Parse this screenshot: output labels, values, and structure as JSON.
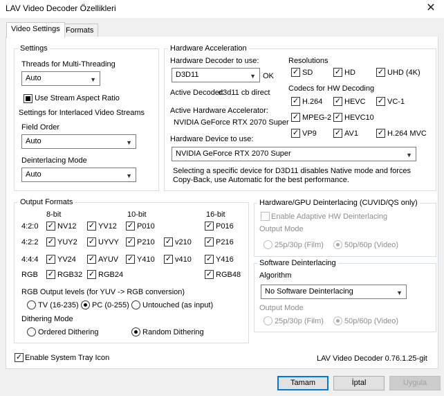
{
  "window": {
    "title": "LAV Video Decoder Özellikleri",
    "close_glyph": "✕"
  },
  "tabs": [
    {
      "label": "Video Settings"
    },
    {
      "label": "Formats"
    }
  ],
  "settings": {
    "group_label": "Settings",
    "threads_label": "Threads for Multi-Threading",
    "threads_value": "Auto",
    "stream_aspect_label": "Use Stream Aspect Ratio",
    "interlaced_label": "Settings for Interlaced Video Streams",
    "field_order_label": "Field Order",
    "field_order_value": "Auto",
    "deint_mode_label": "Deinterlacing Mode",
    "deint_mode_value": "Auto"
  },
  "hwaccel": {
    "group_label": "Hardware Acceleration",
    "decoder_label": "Hardware Decoder to use:",
    "decoder_value": "D3D11",
    "decoder_status": "OK",
    "active_decoder_label": "Active Decoder:",
    "active_decoder_value": "d3d11 cb direct",
    "active_accel_label": "Active Hardware Accelerator:",
    "active_accel_value": "NVIDIA GeForce RTX 2070 Super",
    "device_label": "Hardware Device to use:",
    "device_value": "NVIDIA GeForce RTX 2070 Super",
    "note_line1": "Selecting a specific device for D3D11 disables Native mode and forces",
    "note_line2": "Copy-Back, use Automatic for the best performance.",
    "resolutions_label": "Resolutions",
    "resolutions": [
      {
        "label": "SD",
        "checked": true
      },
      {
        "label": "HD",
        "checked": true
      },
      {
        "label": "UHD (4K)",
        "checked": true
      }
    ],
    "codecs_label": "Codecs for HW Decoding",
    "codecs": [
      {
        "label": "H.264",
        "checked": true
      },
      {
        "label": "HEVC",
        "checked": true
      },
      {
        "label": "VC-1",
        "checked": true
      },
      {
        "label": "MPEG-2",
        "checked": true
      },
      {
        "label": "HEVC10",
        "checked": true
      },
      {
        "label": "VP9",
        "checked": true
      },
      {
        "label": "AV1",
        "checked": true
      },
      {
        "label": "H.264 MVC",
        "checked": true
      }
    ]
  },
  "output_formats": {
    "group_label": "Output Formats",
    "col_8bit": "8-bit",
    "col_10bit": "10-bit",
    "col_16bit": "16-bit",
    "row_420": "4:2:0",
    "row_422": "4:2:2",
    "row_444": "4:4:4",
    "row_rgb": "RGB",
    "formats": {
      "nv12": "NV12",
      "yv12": "YV12",
      "p010": "P010",
      "p016": "P016",
      "yuy2": "YUY2",
      "uyvy": "UYVY",
      "p210": "P210",
      "v210": "v210",
      "p216": "P216",
      "yv24": "YV24",
      "ayuv": "AYUV",
      "y410": "Y410",
      "v410": "v410",
      "y416": "Y416",
      "rgb32": "RGB32",
      "rgb24": "RGB24",
      "rgb48": "RGB48"
    },
    "rgb_levels_label": "RGB Output levels (for YUV -> RGB conversion)",
    "rgb_levels": [
      "TV (16-235)",
      "PC (0-255)",
      "Untouched (as input)"
    ],
    "rgb_levels_selected": "PC (0-255)",
    "dithering_label": "Dithering Mode",
    "dithering": [
      "Ordered Dithering",
      "Random Dithering"
    ],
    "dithering_selected": "Random Dithering"
  },
  "hw_deint": {
    "group_label": "Hardware/GPU Deinterlacing (CUVID/QS only)",
    "enable_label": "Enable Adaptive HW Deinterlacing",
    "output_mode_label": "Output Mode",
    "opt_film": "25p/30p (Film)",
    "opt_video": "50p/60p (Video)"
  },
  "sw_deint": {
    "group_label": "Software Deinterlacing",
    "algorithm_label": "Algorithm",
    "algorithm_value": "No Software Deinterlacing",
    "output_mode_label": "Output Mode",
    "opt_film": "25p/30p (Film)",
    "opt_video": "50p/60p (Video)"
  },
  "footer": {
    "tray_label": "Enable System Tray Icon",
    "version": "LAV Video Decoder 0.76.1.25-git"
  },
  "buttons": {
    "ok": "Tamam",
    "cancel": "İptal",
    "apply": "Uygula"
  },
  "glyphs": {
    "check": "✓",
    "arrow": "▼"
  }
}
